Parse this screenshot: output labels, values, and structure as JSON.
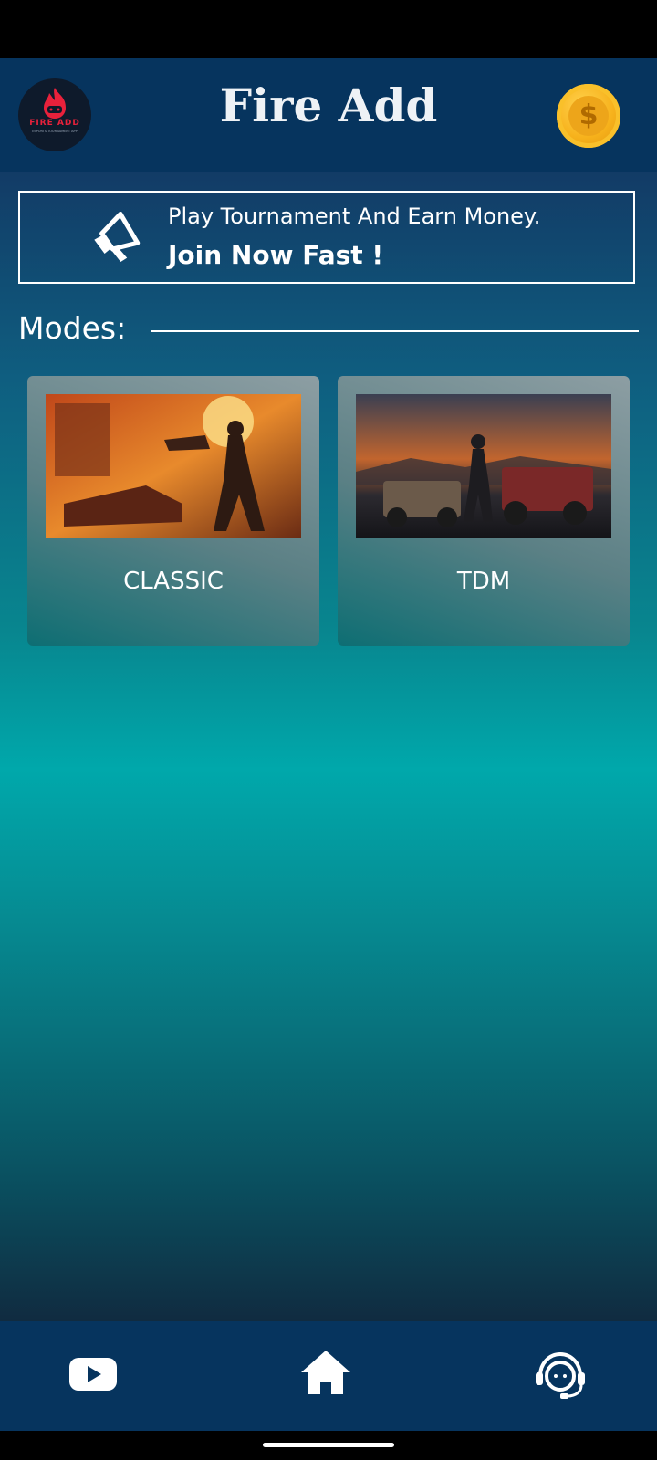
{
  "header": {
    "title": "Fire Add",
    "logo_text": "FIRE ADD",
    "logo_tagline": "ESPORTS TOURNAMENT APP"
  },
  "announcement": {
    "line1": "Play Tournament And Earn Money.",
    "line2": "Join Now Fast !"
  },
  "modes": {
    "label": "Modes:",
    "items": [
      {
        "label": "CLASSIC"
      },
      {
        "label": "TDM"
      }
    ]
  },
  "icons": {
    "logo": "fire-add-logo",
    "coin": "coin-icon",
    "megaphone": "megaphone-icon",
    "nav": [
      "youtube-icon",
      "home-icon",
      "support-icon"
    ]
  },
  "colors": {
    "header_bg": "#06345e",
    "accent_coin": "#f7b21c",
    "logo_red": "#e8213b"
  }
}
